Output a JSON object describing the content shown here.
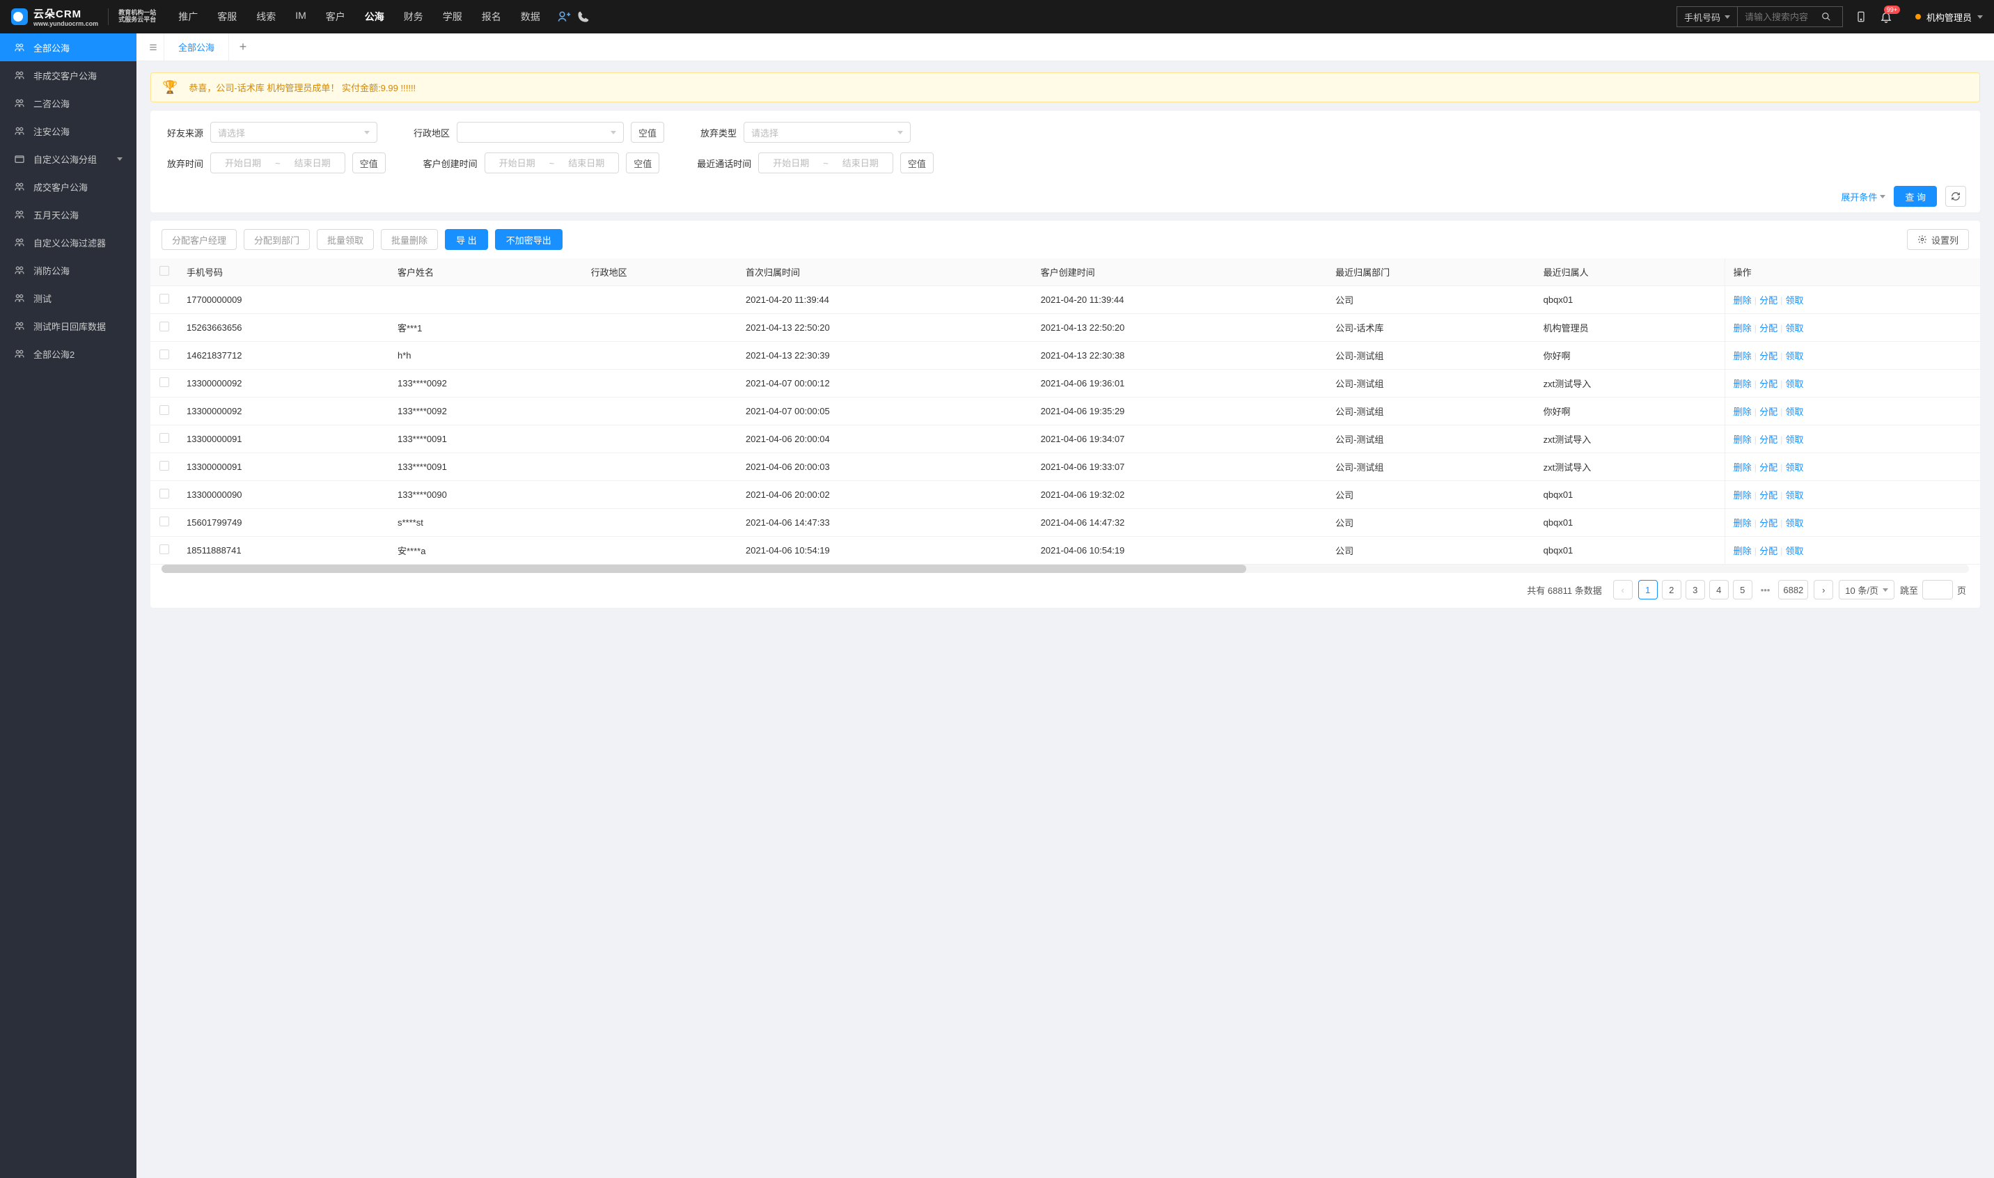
{
  "header": {
    "logo_main": "云朵CRM",
    "logo_url": "www.yunduocrm.com",
    "logo_sub1": "教育机构一站",
    "logo_sub2": "式服务云平台",
    "nav": [
      "推广",
      "客服",
      "线索",
      "IM",
      "客户",
      "公海",
      "财务",
      "学服",
      "报名",
      "数据"
    ],
    "nav_active": "公海",
    "search_type": "手机号码",
    "search_placeholder": "请输入搜索内容",
    "notif_badge": "99+",
    "user_name": "机构管理员"
  },
  "sidebar": {
    "items": [
      {
        "label": "全部公海",
        "icon": "users",
        "active": true
      },
      {
        "label": "非成交客户公海",
        "icon": "users"
      },
      {
        "label": "二咨公海",
        "icon": "users"
      },
      {
        "label": "注安公海",
        "icon": "users"
      },
      {
        "label": "自定义公海分组",
        "icon": "folder",
        "expandable": true
      },
      {
        "label": "成交客户公海",
        "icon": "users"
      },
      {
        "label": "五月天公海",
        "icon": "users"
      },
      {
        "label": "自定义公海过滤器",
        "icon": "users"
      },
      {
        "label": "消防公海",
        "icon": "users"
      },
      {
        "label": "测试",
        "icon": "users"
      },
      {
        "label": "测试昨日回库数据",
        "icon": "users"
      },
      {
        "label": "全部公海2",
        "icon": "users"
      }
    ]
  },
  "tabs": {
    "active_tab": "全部公海"
  },
  "alert": {
    "text": "恭喜，公司-话术库  机构管理员成单！  实付金额:9.99 !!!!!!"
  },
  "filters": {
    "row1": [
      {
        "label": "好友来源",
        "placeholder": "请选择",
        "type": "select"
      },
      {
        "label": "行政地区",
        "placeholder": "",
        "type": "select",
        "null_btn": "空值"
      },
      {
        "label": "放弃类型",
        "placeholder": "请选择",
        "type": "select"
      }
    ],
    "row2": [
      {
        "label": "放弃时间",
        "start": "开始日期",
        "end": "结束日期",
        "type": "daterange",
        "null_btn": "空值"
      },
      {
        "label": "客户创建时间",
        "start": "开始日期",
        "end": "结束日期",
        "type": "daterange",
        "null_btn": "空值",
        "wide": true
      },
      {
        "label": "最近通话时间",
        "start": "开始日期",
        "end": "结束日期",
        "type": "daterange",
        "null_btn": "空值",
        "wide": true
      }
    ],
    "expand_label": "展开条件",
    "query_label": "查 询"
  },
  "toolbar": {
    "assign_manager": "分配客户经理",
    "assign_dept": "分配到部门",
    "batch_claim": "批量领取",
    "batch_delete": "批量删除",
    "export": "导 出",
    "export_plain": "不加密导出",
    "set_columns": "设置列"
  },
  "table": {
    "columns": [
      "手机号码",
      "客户姓名",
      "行政地区",
      "首次归属时间",
      "客户创建时间",
      "最近归属部门",
      "最近归属人",
      "操作"
    ],
    "actions": {
      "delete": "删除",
      "assign": "分配",
      "claim": "领取"
    },
    "rows": [
      {
        "phone": "17700000009",
        "name": "",
        "region": "",
        "first_time": "2021-04-20 11:39:44",
        "create_time": "2021-04-20 11:39:44",
        "dept": "公司",
        "owner": "qbqx01"
      },
      {
        "phone": "15263663656",
        "name": "客***1",
        "region": "",
        "first_time": "2021-04-13 22:50:20",
        "create_time": "2021-04-13 22:50:20",
        "dept": "公司-话术库",
        "owner": "机构管理员"
      },
      {
        "phone": "14621837712",
        "name": "h*h",
        "region": "",
        "first_time": "2021-04-13 22:30:39",
        "create_time": "2021-04-13 22:30:38",
        "dept": "公司-测试组",
        "owner": "你好啊"
      },
      {
        "phone": "13300000092",
        "name": "133****0092",
        "region": "",
        "first_time": "2021-04-07 00:00:12",
        "create_time": "2021-04-06 19:36:01",
        "dept": "公司-测试组",
        "owner": "zxt测试导入"
      },
      {
        "phone": "13300000092",
        "name": "133****0092",
        "region": "",
        "first_time": "2021-04-07 00:00:05",
        "create_time": "2021-04-06 19:35:29",
        "dept": "公司-测试组",
        "owner": "你好啊"
      },
      {
        "phone": "13300000091",
        "name": "133****0091",
        "region": "",
        "first_time": "2021-04-06 20:00:04",
        "create_time": "2021-04-06 19:34:07",
        "dept": "公司-测试组",
        "owner": "zxt测试导入"
      },
      {
        "phone": "13300000091",
        "name": "133****0091",
        "region": "",
        "first_time": "2021-04-06 20:00:03",
        "create_time": "2021-04-06 19:33:07",
        "dept": "公司-测试组",
        "owner": "zxt测试导入"
      },
      {
        "phone": "13300000090",
        "name": "133****0090",
        "region": "",
        "first_time": "2021-04-06 20:00:02",
        "create_time": "2021-04-06 19:32:02",
        "dept": "公司",
        "owner": "qbqx01"
      },
      {
        "phone": "15601799749",
        "name": "s****st",
        "region": "",
        "first_time": "2021-04-06 14:47:33",
        "create_time": "2021-04-06 14:47:32",
        "dept": "公司",
        "owner": "qbqx01"
      },
      {
        "phone": "18511888741",
        "name": "安****a",
        "region": "",
        "first_time": "2021-04-06 10:54:19",
        "create_time": "2021-04-06 10:54:19",
        "dept": "公司",
        "owner": "qbqx01"
      }
    ]
  },
  "pagination": {
    "total_prefix": "共有",
    "total": "68811",
    "total_suffix": "条数据",
    "pages": [
      "1",
      "2",
      "3",
      "4",
      "5"
    ],
    "last_page": "6882",
    "page_size": "10 条/页",
    "jump_label": "跳至",
    "jump_suffix": "页"
  }
}
